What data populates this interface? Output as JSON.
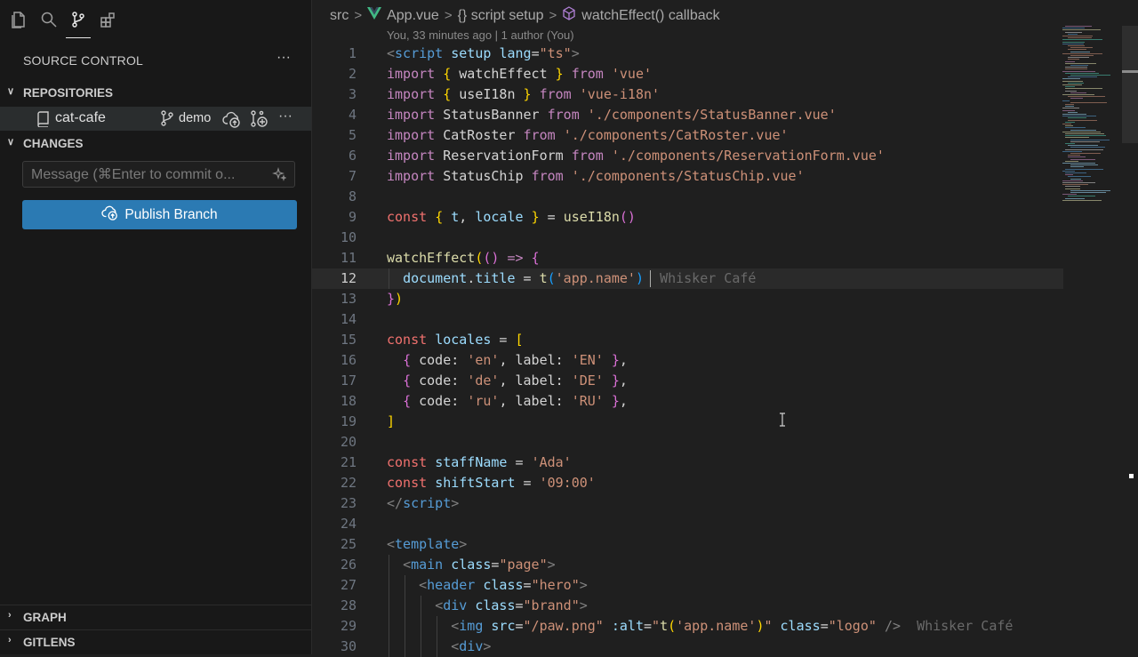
{
  "activity_bar": {
    "icons": [
      "explorer-icon",
      "search-icon",
      "source-control-icon",
      "extensions-icon"
    ],
    "active": "source-control-icon"
  },
  "source_control": {
    "title": "SOURCE CONTROL",
    "more": "···",
    "repositories": {
      "header": "REPOSITORIES",
      "repo_name": "cat-cafe",
      "branch": "demo",
      "more": "···"
    },
    "changes": {
      "header": "CHANGES",
      "message_placeholder": "Message (⌘Enter to commit o...",
      "publish_label": "Publish Branch"
    },
    "bottom_sections": [
      "GRAPH",
      "GITLENS"
    ]
  },
  "breadcrumb": {
    "items": [
      "src",
      "App.vue",
      "{} script setup",
      "watchEffect() callback"
    ]
  },
  "blame": "You, 33 minutes ago | 1 author (You)",
  "editor": {
    "current_line": 12,
    "lines": [
      {
        "n": "1",
        "segs": [
          [
            "g",
            "<"
          ],
          [
            "tag",
            "script"
          ],
          [
            "p",
            " "
          ],
          [
            "attr",
            "setup"
          ],
          [
            "p",
            " "
          ],
          [
            "attr",
            "lang"
          ],
          [
            "p",
            "="
          ],
          [
            "s",
            "\"ts\""
          ],
          [
            "g",
            ">"
          ]
        ]
      },
      {
        "n": "2",
        "segs": [
          [
            "im",
            "import"
          ],
          [
            "p",
            " "
          ],
          [
            "b1",
            "{"
          ],
          [
            "p",
            " watchEffect "
          ],
          [
            "b1",
            "}"
          ],
          [
            "p",
            " "
          ],
          [
            "im",
            "from"
          ],
          [
            "p",
            " "
          ],
          [
            "s",
            "'vue'"
          ]
        ]
      },
      {
        "n": "3",
        "segs": [
          [
            "im",
            "import"
          ],
          [
            "p",
            " "
          ],
          [
            "b1",
            "{"
          ],
          [
            "p",
            " useI18n "
          ],
          [
            "b1",
            "}"
          ],
          [
            "p",
            " "
          ],
          [
            "im",
            "from"
          ],
          [
            "p",
            " "
          ],
          [
            "s",
            "'vue-i18n'"
          ]
        ]
      },
      {
        "n": "4",
        "segs": [
          [
            "im",
            "import"
          ],
          [
            "p",
            " StatusBanner "
          ],
          [
            "im",
            "from"
          ],
          [
            "p",
            " "
          ],
          [
            "s",
            "'./components/StatusBanner.vue'"
          ]
        ]
      },
      {
        "n": "5",
        "segs": [
          [
            "im",
            "import"
          ],
          [
            "p",
            " CatRoster "
          ],
          [
            "im",
            "from"
          ],
          [
            "p",
            " "
          ],
          [
            "s",
            "'./components/CatRoster.vue'"
          ]
        ]
      },
      {
        "n": "6",
        "segs": [
          [
            "im",
            "import"
          ],
          [
            "p",
            " ReservationForm "
          ],
          [
            "im",
            "from"
          ],
          [
            "p",
            " "
          ],
          [
            "s",
            "'./components/ReservationForm.vue'"
          ]
        ]
      },
      {
        "n": "7",
        "segs": [
          [
            "im",
            "import"
          ],
          [
            "p",
            " StatusChip "
          ],
          [
            "im",
            "from"
          ],
          [
            "p",
            " "
          ],
          [
            "s",
            "'./components/StatusChip.vue'"
          ]
        ]
      },
      {
        "n": "8",
        "segs": []
      },
      {
        "n": "9",
        "segs": [
          [
            "decl",
            "const"
          ],
          [
            "p",
            " "
          ],
          [
            "b1",
            "{"
          ],
          [
            "p",
            " "
          ],
          [
            "v",
            "t"
          ],
          [
            "p",
            ", "
          ],
          [
            "v",
            "locale"
          ],
          [
            "p",
            " "
          ],
          [
            "b1",
            "}"
          ],
          [
            "p",
            " = "
          ],
          [
            "f",
            "useI18n"
          ],
          [
            "b2",
            "()"
          ]
        ]
      },
      {
        "n": "10",
        "segs": []
      },
      {
        "n": "11",
        "segs": [
          [
            "f",
            "watchEffect"
          ],
          [
            "b1",
            "("
          ],
          [
            "b2",
            "()"
          ],
          [
            "p",
            " "
          ],
          [
            "kw",
            "=>"
          ],
          [
            "p",
            " "
          ],
          [
            "b2",
            "{"
          ]
        ]
      },
      {
        "n": "12",
        "segs": [
          [
            "p",
            "  "
          ],
          [
            "v",
            "document"
          ],
          [
            "p",
            "."
          ],
          [
            "v",
            "title"
          ],
          [
            "p",
            " = "
          ],
          [
            "f",
            "t"
          ],
          [
            "b3",
            "("
          ],
          [
            "s",
            "'app.name'"
          ],
          [
            "b3",
            ")"
          ],
          [
            "p",
            "  "
          ]
        ],
        "ghost": "Whisker Café"
      },
      {
        "n": "13",
        "segs": [
          [
            "b2",
            "}"
          ],
          [
            "b1",
            ")"
          ]
        ]
      },
      {
        "n": "14",
        "segs": []
      },
      {
        "n": "15",
        "segs": [
          [
            "decl",
            "const"
          ],
          [
            "p",
            " "
          ],
          [
            "v",
            "locales"
          ],
          [
            "p",
            " = "
          ],
          [
            "b1",
            "["
          ]
        ]
      },
      {
        "n": "16",
        "segs": [
          [
            "p",
            "  "
          ],
          [
            "b2",
            "{"
          ],
          [
            "p",
            " code: "
          ],
          [
            "s",
            "'en'"
          ],
          [
            "p",
            ", label: "
          ],
          [
            "s",
            "'EN'"
          ],
          [
            "p",
            " "
          ],
          [
            "b2",
            "}"
          ],
          [
            "p",
            ","
          ]
        ]
      },
      {
        "n": "17",
        "segs": [
          [
            "p",
            "  "
          ],
          [
            "b2",
            "{"
          ],
          [
            "p",
            " code: "
          ],
          [
            "s",
            "'de'"
          ],
          [
            "p",
            ", label: "
          ],
          [
            "s",
            "'DE'"
          ],
          [
            "p",
            " "
          ],
          [
            "b2",
            "}"
          ],
          [
            "p",
            ","
          ]
        ]
      },
      {
        "n": "18",
        "segs": [
          [
            "p",
            "  "
          ],
          [
            "b2",
            "{"
          ],
          [
            "p",
            " code: "
          ],
          [
            "s",
            "'ru'"
          ],
          [
            "p",
            ", label: "
          ],
          [
            "s",
            "'RU'"
          ],
          [
            "p",
            " "
          ],
          [
            "b2",
            "}"
          ],
          [
            "p",
            ","
          ]
        ]
      },
      {
        "n": "19",
        "segs": [
          [
            "b1",
            "]"
          ]
        ]
      },
      {
        "n": "20",
        "segs": []
      },
      {
        "n": "21",
        "segs": [
          [
            "decl",
            "const"
          ],
          [
            "p",
            " "
          ],
          [
            "v",
            "staffName"
          ],
          [
            "p",
            " = "
          ],
          [
            "s",
            "'Ada'"
          ]
        ]
      },
      {
        "n": "22",
        "segs": [
          [
            "decl",
            "const"
          ],
          [
            "p",
            " "
          ],
          [
            "v",
            "shiftStart"
          ],
          [
            "p",
            " = "
          ],
          [
            "s",
            "'09:00'"
          ]
        ]
      },
      {
        "n": "23",
        "segs": [
          [
            "g",
            "</"
          ],
          [
            "tag",
            "script"
          ],
          [
            "g",
            ">"
          ]
        ]
      },
      {
        "n": "24",
        "segs": []
      },
      {
        "n": "25",
        "segs": [
          [
            "g",
            "<"
          ],
          [
            "tag",
            "template"
          ],
          [
            "g",
            ">"
          ]
        ]
      },
      {
        "n": "26",
        "segs": [
          [
            "p",
            "  "
          ],
          [
            "g",
            "<"
          ],
          [
            "tag",
            "main"
          ],
          [
            "p",
            " "
          ],
          [
            "attr",
            "class"
          ],
          [
            "p",
            "="
          ],
          [
            "s",
            "\"page\""
          ],
          [
            "g",
            ">"
          ]
        ]
      },
      {
        "n": "27",
        "segs": [
          [
            "p",
            "    "
          ],
          [
            "g",
            "<"
          ],
          [
            "tag",
            "header"
          ],
          [
            "p",
            " "
          ],
          [
            "attr",
            "class"
          ],
          [
            "p",
            "="
          ],
          [
            "s",
            "\"hero\""
          ],
          [
            "g",
            ">"
          ]
        ]
      },
      {
        "n": "28",
        "segs": [
          [
            "p",
            "      "
          ],
          [
            "g",
            "<"
          ],
          [
            "tag",
            "div"
          ],
          [
            "p",
            " "
          ],
          [
            "attr",
            "class"
          ],
          [
            "p",
            "="
          ],
          [
            "s",
            "\"brand\""
          ],
          [
            "g",
            ">"
          ]
        ]
      },
      {
        "n": "29",
        "segs": [
          [
            "p",
            "        "
          ],
          [
            "g",
            "<"
          ],
          [
            "tag",
            "img"
          ],
          [
            "p",
            " "
          ],
          [
            "attr",
            "src"
          ],
          [
            "p",
            "="
          ],
          [
            "s",
            "\"/paw.png\""
          ],
          [
            "p",
            " "
          ],
          [
            "attr",
            ":alt"
          ],
          [
            "p",
            "="
          ],
          [
            "s",
            "\""
          ],
          [
            "f",
            "t"
          ],
          [
            "b1",
            "("
          ],
          [
            "s",
            "'app.name'"
          ],
          [
            "b1",
            ")"
          ],
          [
            "s",
            "\""
          ],
          [
            "p",
            " "
          ],
          [
            "attr",
            "class"
          ],
          [
            "p",
            "="
          ],
          [
            "s",
            "\"logo\""
          ],
          [
            "p",
            " "
          ],
          [
            "g",
            "/>"
          ],
          [
            "p",
            "  "
          ]
        ],
        "ghost": "Whisker Café"
      },
      {
        "n": "30",
        "segs": [
          [
            "p",
            "        "
          ],
          [
            "g",
            "<"
          ],
          [
            "tag",
            "div"
          ],
          [
            "g",
            ">"
          ]
        ]
      }
    ]
  }
}
